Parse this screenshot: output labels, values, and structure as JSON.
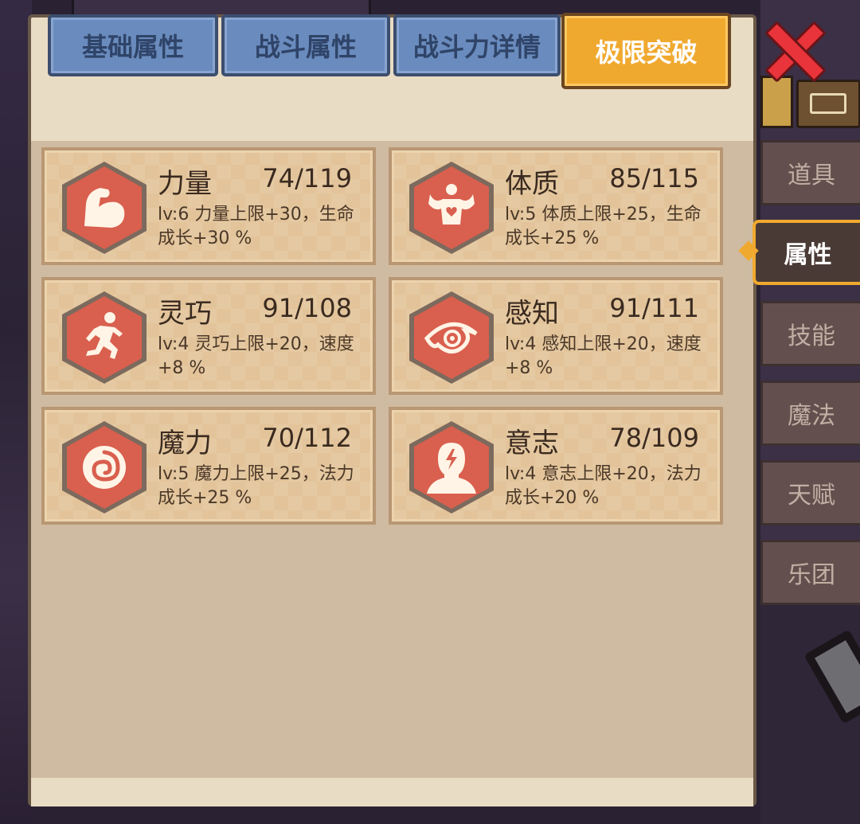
{
  "tabs": [
    {
      "label": "基础属性",
      "active": false
    },
    {
      "label": "战斗属性",
      "active": false
    },
    {
      "label": "战斗力详情",
      "active": false
    },
    {
      "label": "极限突破",
      "active": true
    }
  ],
  "side_tabs": [
    {
      "label": "道具",
      "active": false
    },
    {
      "label": "属性",
      "active": true
    },
    {
      "label": "技能",
      "active": false
    },
    {
      "label": "魔法",
      "active": false
    },
    {
      "label": "天赋",
      "active": false
    },
    {
      "label": "乐团",
      "active": false
    }
  ],
  "attributes": [
    {
      "name": "力量",
      "value": "74/119",
      "desc": "lv:6 力量上限+30，生命成长+30 %",
      "icon": "muscle-arm-icon"
    },
    {
      "name": "体质",
      "value": "85/115",
      "desc": "lv:5 体质上限+25，生命成长+25 %",
      "icon": "body-heart-icon"
    },
    {
      "name": "灵巧",
      "value": "91/108",
      "desc": "lv:4 灵巧上限+20，速度+8 %",
      "icon": "running-man-icon"
    },
    {
      "name": "感知",
      "value": "91/111",
      "desc": "lv:4 感知上限+20，速度+8 %",
      "icon": "eye-icon"
    },
    {
      "name": "魔力",
      "value": "70/112",
      "desc": "lv:5 魔力上限+25，法力成长+25 %",
      "icon": "spiral-orb-icon"
    },
    {
      "name": "意志",
      "value": "78/109",
      "desc": "lv:4 意志上限+20，法力成长+20 %",
      "icon": "head-bolt-icon"
    }
  ],
  "colors": {
    "active_tab": "#f0a92f",
    "inactive_tab": "#6a8bbd",
    "icon_bg": "#d95f4e",
    "panel": "#e9dcc4"
  }
}
